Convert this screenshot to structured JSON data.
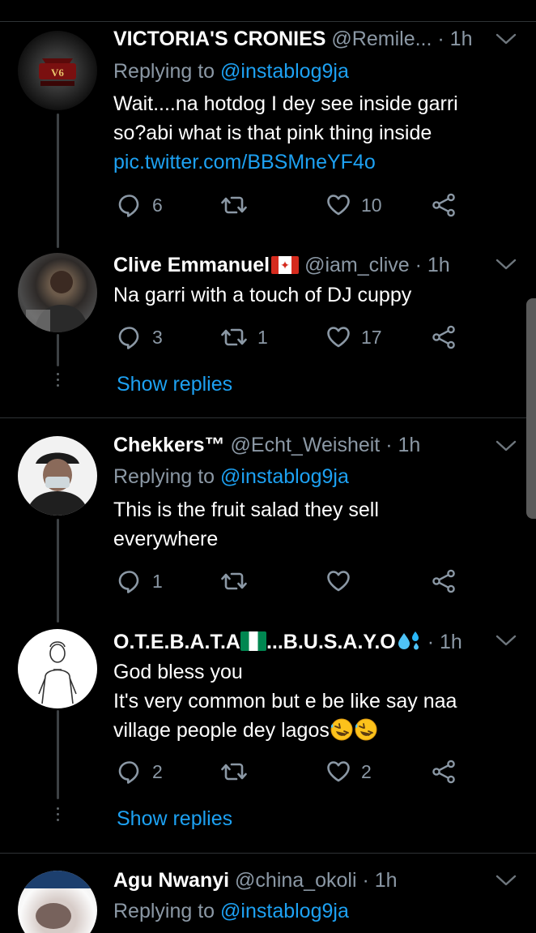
{
  "tweets": [
    {
      "name": "VICTORIA'S CRONIES",
      "handle": "@Remile...",
      "time": "· 1h",
      "replying_prefix": "Replying to ",
      "replying_to": "@instablog9ja",
      "text_lines": [
        "Wait....na hotdog I dey see inside garri",
        "so?abi what is that pink thing inside"
      ],
      "link": "pic.twitter.com/BBSMneYF4o",
      "replies": "6",
      "retweets": "",
      "likes": "10",
      "avatar_badge": "V6"
    },
    {
      "name": "Clive Emmanuel",
      "handle": "@iam_clive",
      "time": "· 1h",
      "text_lines": [
        "Na garri with a touch of DJ cuppy"
      ],
      "replies": "3",
      "retweets": "1",
      "likes": "17",
      "show_replies": "Show replies"
    },
    {
      "name": "Chekkers™",
      "handle": "@Echt_Weisheit",
      "time": "· 1h",
      "replying_prefix": "Replying to ",
      "replying_to": "@instablog9ja",
      "text_lines": [
        "This is the fruit salad they sell",
        "everywhere"
      ],
      "replies": "1",
      "retweets": "",
      "likes": ""
    },
    {
      "name_part1": "O.T.E.B.A.T.A",
      "name_part2": "...B.U.S.A.Y.O",
      "time": "· 1h",
      "text_lines": [
        "God bless you",
        "It's very common but e be like say naa",
        "village people dey lagos"
      ],
      "replies": "2",
      "retweets": "",
      "likes": "2",
      "show_replies": "Show replies"
    },
    {
      "name": "Agu Nwanyi",
      "handle": "@china_okoli",
      "time": "· 1h",
      "replying_prefix": "Replying to ",
      "replying_to": "@instablog9ja"
    }
  ],
  "icons": {
    "reply": "reply-icon",
    "retweet": "retweet-icon",
    "like": "heart-icon",
    "share": "share-icon",
    "more": "chevron-down-icon"
  },
  "colors": {
    "background": "#000000",
    "accent": "#1da1f2",
    "muted": "#8b98a5",
    "divider": "#2f3336"
  }
}
